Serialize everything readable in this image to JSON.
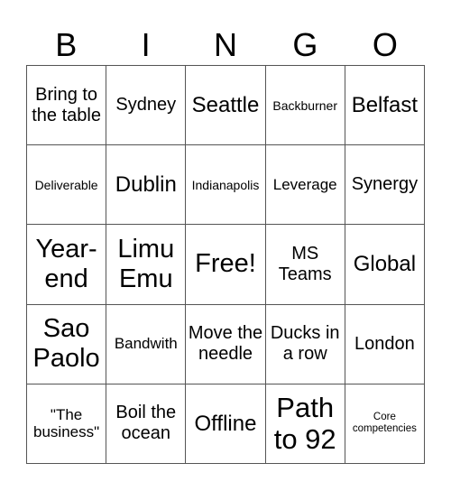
{
  "header": [
    "B",
    "I",
    "N",
    "G",
    "O"
  ],
  "cells": [
    [
      "Bring to the table",
      "Sydney",
      "Seattle",
      "Backburner",
      "Belfast"
    ],
    [
      "Deliverable",
      "Dublin",
      "Indianapolis",
      "Leverage",
      "Synergy"
    ],
    [
      "Year-end",
      "Limu Emu",
      "Free!",
      "MS Teams",
      "Global"
    ],
    [
      "Sao Paolo",
      "Bandwith",
      "Move the needle",
      "Ducks in a row",
      "London"
    ],
    [
      "\"The business\"",
      "Boil the ocean",
      "Offline",
      "Path to 92",
      "Core competencies"
    ]
  ]
}
